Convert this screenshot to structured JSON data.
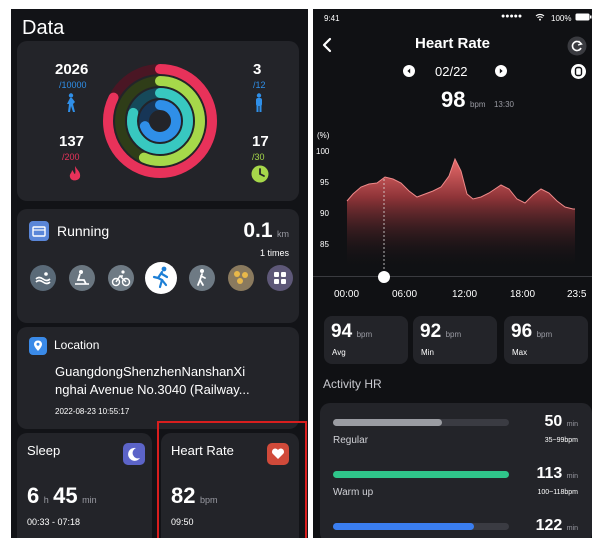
{
  "left": {
    "title": "Data",
    "rings": {
      "steps": {
        "value": "2026",
        "goal": "/10000",
        "color": "#2f8fe8"
      },
      "standing": {
        "value": "3",
        "goal": "/12",
        "color": "#2f8fe8"
      },
      "calories": {
        "value": "137",
        "goal": "/200",
        "color": "#e8325a"
      },
      "exercise": {
        "value": "17",
        "goal": "/30",
        "color": "#a6d84a"
      }
    },
    "running": {
      "label": "Running",
      "distance": "0.1",
      "unit": "km",
      "times": "1 times",
      "sports": [
        "swim-icon",
        "rowing-icon",
        "cycling-icon",
        "running-icon",
        "walking-icon",
        "hiking-icon",
        "more-icon"
      ]
    },
    "location": {
      "label": "Location",
      "line1": "GuangdongShenzhenNanshanXi",
      "line2": "nghai Avenue No.3040 (Railway...",
      "time": "2022-08-23 10:55:17"
    },
    "sleep": {
      "label": "Sleep",
      "hours": "6",
      "h": "h",
      "minutes": "45",
      "min": "min",
      "range": "00:33 - 07:18"
    },
    "heart": {
      "label": "Heart Rate",
      "value": "82",
      "unit": "bpm",
      "time": "09:50"
    }
  },
  "right": {
    "status": {
      "time": "9:41",
      "signal": "●●●●● ",
      "battery": "100%"
    },
    "title": "Heart Rate",
    "date": "02/22",
    "current": {
      "value": "98",
      "unit": "bpm",
      "time": "13:30"
    },
    "axis_unit": "(%)",
    "y_ticks": [
      "100",
      "95",
      "90",
      "85"
    ],
    "x_ticks": [
      "00:00",
      "06:00",
      "12:00",
      "18:00",
      "23:5"
    ],
    "stats": [
      {
        "value": "94",
        "unit": "bpm",
        "label": "Avg"
      },
      {
        "value": "92",
        "unit": "bpm",
        "label": "Min"
      },
      {
        "value": "96",
        "unit": "bpm",
        "label": "Max"
      }
    ],
    "activity_title": "Activity HR",
    "zones": [
      {
        "name": "Regular",
        "minutes": "50",
        "unit": "min",
        "range": "35~99bpm",
        "color": "#9a9ca2",
        "fill": 0.62
      },
      {
        "name": "Warm up",
        "minutes": "113",
        "unit": "min",
        "range": "100~118bpm",
        "color": "#2fc58a",
        "fill": 1.0
      },
      {
        "name": "",
        "minutes": "122",
        "unit": "min",
        "range": "",
        "color": "#3a7ef0",
        "fill": 0.8
      }
    ]
  }
}
